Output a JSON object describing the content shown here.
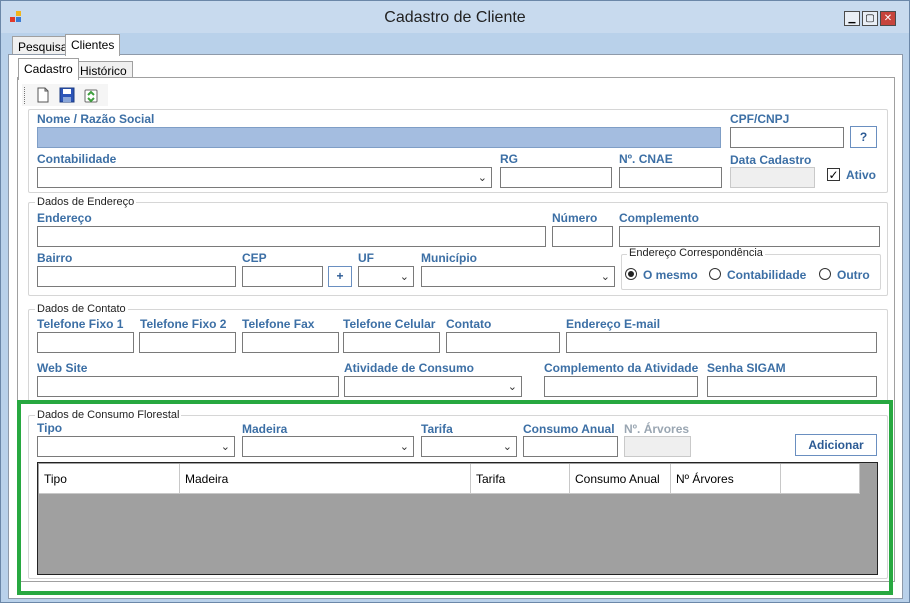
{
  "window": {
    "title": "Cadastro de Cliente"
  },
  "controls": {
    "minimize": "▁",
    "maximize": "▢",
    "close": "✕"
  },
  "outer_tabs": [
    "Pesquisa",
    "Clientes"
  ],
  "inner_tabs": [
    "Cadastro",
    "Histórico"
  ],
  "toolbar": {
    "icons": [
      "new-document-icon",
      "save-icon",
      "recycle-icon"
    ]
  },
  "cliente": {
    "nome_label": "Nome / Razão Social",
    "cpf_label": "CPF/CNPJ",
    "cpf_help": "?",
    "contabilidade_label": "Contabilidade",
    "rg_label": "RG",
    "cnae_label": "Nº. CNAE",
    "data_cadastro_label": "Data Cadastro",
    "ativo_label": "Ativo",
    "ativo_checked": true
  },
  "endereco": {
    "group_title": "Dados de Endereço",
    "endereco_label": "Endereço",
    "numero_label": "Número",
    "complemento_label": "Complemento",
    "bairro_label": "Bairro",
    "cep_label": "CEP",
    "cep_add": "+",
    "uf_label": "UF",
    "municipio_label": "Município",
    "correspondencia_title": "Endereço Correspondência",
    "opt_mesmo": "O mesmo",
    "opt_contabilidade": "Contabilidade",
    "opt_outro": "Outro",
    "selected": "O mesmo"
  },
  "contato": {
    "group_title": "Dados de Contato",
    "tel_fixo1": "Telefone Fixo 1",
    "tel_fixo2": "Telefone Fixo 2",
    "tel_fax": "Telefone Fax",
    "tel_celular": "Telefone Celular",
    "contato": "Contato",
    "email": "Endereço E-mail",
    "website": "Web Site",
    "atividade": "Atividade de Consumo",
    "complemento_atividade": "Complemento da Atividade",
    "senha_sigam": "Senha SIGAM"
  },
  "consumo": {
    "group_title": "Dados de Consumo Florestal",
    "tipo_label": "Tipo",
    "madeira_label": "Madeira",
    "tarifa_label": "Tarifa",
    "consumo_anual_label": "Consumo Anual",
    "arvores_label": "Nº. Árvores",
    "adicionar": "Adicionar",
    "columns": [
      "Tipo",
      "Madeira",
      "Tarifa",
      "Consumo Anual",
      "Nº Árvores",
      ""
    ]
  }
}
